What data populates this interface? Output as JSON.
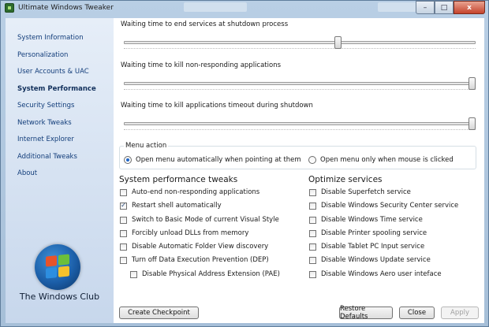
{
  "window": {
    "title": "Ultimate Windows Tweaker"
  },
  "caption_buttons": {
    "minimize": "–",
    "maximize": "□",
    "close": "x"
  },
  "sidebar": {
    "items": [
      {
        "label": "System Information"
      },
      {
        "label": "Personalization"
      },
      {
        "label": "User Accounts & UAC"
      },
      {
        "label": "System Performance"
      },
      {
        "label": "Security Settings"
      },
      {
        "label": "Network Tweaks"
      },
      {
        "label": "Internet Explorer"
      },
      {
        "label": "Additional Tweaks"
      },
      {
        "label": "About"
      }
    ],
    "active_index": 3,
    "logo_icon": "windows-flag-icon",
    "brand": "The Windows Club"
  },
  "sliders": [
    {
      "label": "Waiting time to end services at shutdown process",
      "level_percent": 61
    },
    {
      "label": "Waiting time to kill non-responding applications",
      "level_percent": 100
    },
    {
      "label": "Waiting time to kill applications timeout during shutdown",
      "level_percent": 100
    }
  ],
  "menu_action": {
    "legend": "Menu action",
    "options": [
      {
        "label": "Open menu automatically when pointing at them",
        "selected": true
      },
      {
        "label": "Open menu only when mouse is clicked",
        "selected": false
      }
    ]
  },
  "performance_tweaks": {
    "title": "System performance tweaks",
    "items": [
      {
        "label": "Auto-end non-responding applications",
        "checked": false
      },
      {
        "label": "Restart shell automatically",
        "checked": true
      },
      {
        "label": "Switch to Basic Mode of current Visual Style",
        "checked": false
      },
      {
        "label": "Forcibly unload DLLs from memory",
        "checked": false
      },
      {
        "label": "Disable Automatic Folder View discovery",
        "checked": false
      },
      {
        "label": "Turn off Data Execution Prevention (DEP)",
        "checked": false
      },
      {
        "label": "Disable Physical Address Extension (PAE)",
        "checked": false
      }
    ]
  },
  "optimize_services": {
    "title": "Optimize services",
    "items": [
      {
        "label": "Disable Superfetch service",
        "checked": false
      },
      {
        "label": "Disable Windows Security Center service",
        "checked": false
      },
      {
        "label": "Disable Windows Time service",
        "checked": false
      },
      {
        "label": "Disable Printer spooling service",
        "checked": false
      },
      {
        "label": "Disable Tablet PC Input service",
        "checked": false
      },
      {
        "label": "Disable Windows Update service",
        "checked": false
      },
      {
        "label": "Disable Windows Aero user inteface",
        "checked": false
      }
    ]
  },
  "buttons": {
    "create_checkpoint": "Create Checkpoint",
    "restore_defaults": "Restore Defaults",
    "close": "Close",
    "apply": "Apply"
  },
  "colors": {
    "frame": "#b9cfe5",
    "sidebar_link": "#123d7a",
    "radio_accent": "#1f66c9"
  }
}
